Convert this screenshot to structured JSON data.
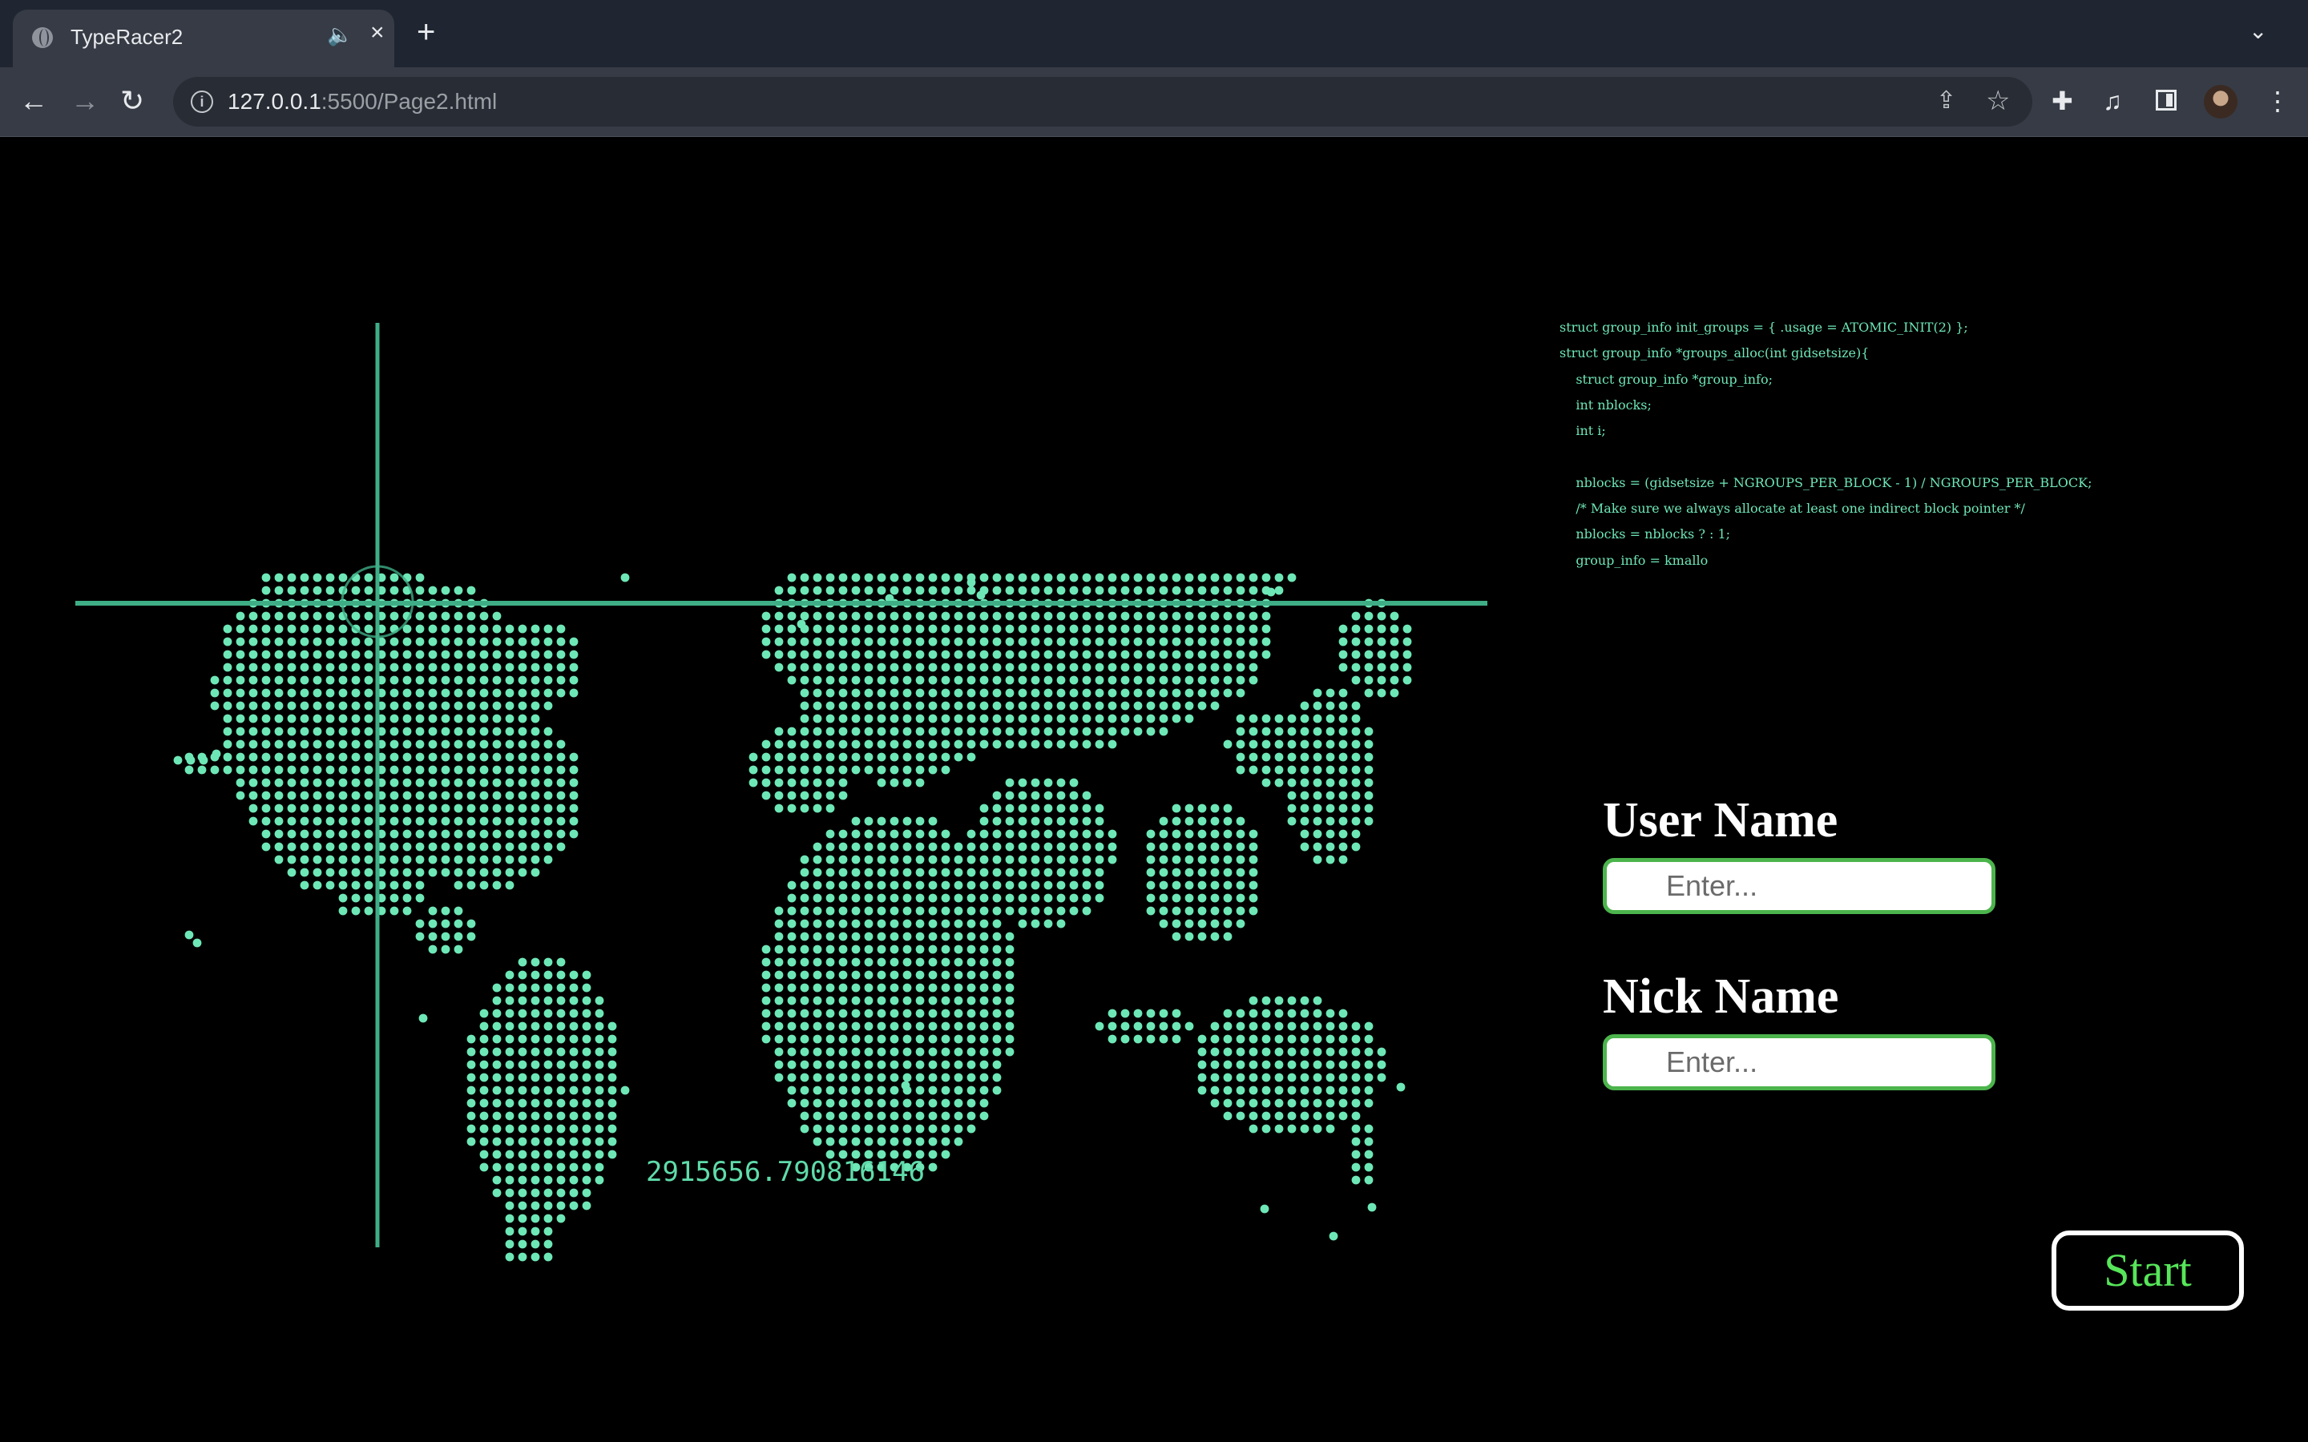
{
  "browser": {
    "tab_title": "TypeRacer2",
    "tab_close": "×",
    "new_tab": "+",
    "tab_list": "⌄",
    "url_host": "127.0.0.1",
    "url_path": ":5500/Page2.html"
  },
  "page": {
    "coordinate_readout": "2915656.790816146",
    "code_lines": [
      "struct group_info init_groups = { .usage = ATOMIC_INIT(2) };",
      "struct group_info *groups_alloc(int gidsetsize){",
      "    struct group_info *group_info;",
      "    int nblocks;",
      "    int i;",
      "",
      "    nblocks = (gidsetsize + NGROUPS_PER_BLOCK - 1) / NGROUPS_PER_BLOCK;",
      "    /* Make sure we always allocate at least one indirect block pointer */",
      "    nblocks = nblocks ? : 1;",
      "    group_info = kmallo"
    ],
    "user_name_label": "User Name",
    "user_name_placeholder": "Enter...",
    "nick_name_label": "Nick Name",
    "nick_name_placeholder": "Enter...",
    "start_label": "Start"
  },
  "colors": {
    "map_dots": "#6ee7b7",
    "crosshair": "#3fae86",
    "input_border": "#4cb44c",
    "start_text": "#57e65a"
  }
}
